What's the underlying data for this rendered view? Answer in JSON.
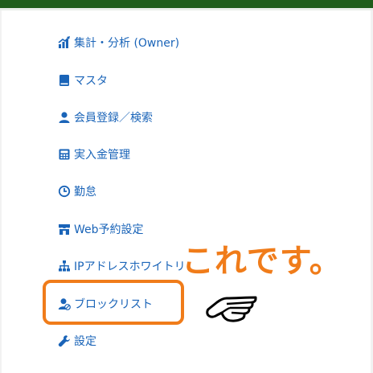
{
  "menu": {
    "items": [
      {
        "label": "集計・分析 (Owner)",
        "icon": "bar-chart-icon"
      },
      {
        "label": "マスタ",
        "icon": "book-icon"
      },
      {
        "label": "会員登録／検索",
        "icon": "user-icon"
      },
      {
        "label": "実入金管理",
        "icon": "calculator-icon"
      },
      {
        "label": "勤怠",
        "icon": "clock-icon"
      },
      {
        "label": "Web予約設定",
        "icon": "storefront-icon"
      },
      {
        "label": "IPアドレスホワイトリ",
        "icon": "sitemap-icon"
      },
      {
        "label": "ブロックリスト",
        "icon": "user-block-icon"
      },
      {
        "label": "設定",
        "icon": "wrench-icon"
      }
    ]
  },
  "annotation": {
    "callout_text": "これです。",
    "highlight_color": "#f07c1a",
    "pointer_icon": "pointing-hand-icon"
  },
  "colors": {
    "link": "#1a64b8",
    "topbar": "#1f5d1a",
    "accent": "#f07c1a"
  }
}
